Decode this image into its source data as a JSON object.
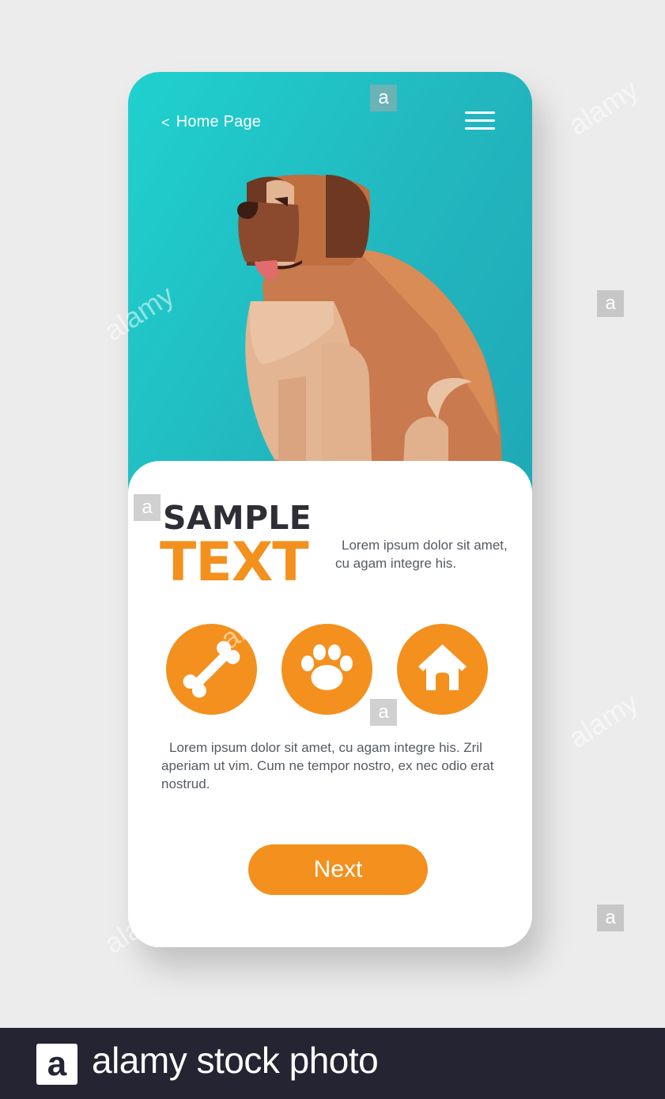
{
  "nav": {
    "back_chevron": "<",
    "back_label": "Home Page",
    "menu_icon": "hamburger-icon"
  },
  "hero": {
    "illustration": "saint-bernard-dog",
    "colors": {
      "bg_start": "#1fd1cf",
      "bg_end": "#1fa8b7"
    }
  },
  "content": {
    "title_line1": "SAMPLE",
    "title_line2": "TEXT",
    "side_text": "Lorem ipsum dolor sit amet, cu agam integre his.",
    "icons": [
      {
        "name": "bone-icon"
      },
      {
        "name": "paw-icon"
      },
      {
        "name": "doghouse-icon"
      }
    ],
    "body_text": "Lorem ipsum dolor sit amet, cu agam integre his. Zril aperiam ut vim. Cum ne tempor nostro, ex nec odio erat nostrud.",
    "next_label": "Next"
  },
  "colors": {
    "accent": "#f3901e",
    "title_dark": "#2f2d35",
    "body_text": "#555a63"
  },
  "watermark": {
    "logo_letter": "a",
    "brand_text": "alamy stock photo",
    "diagonal_text": "alamy"
  }
}
